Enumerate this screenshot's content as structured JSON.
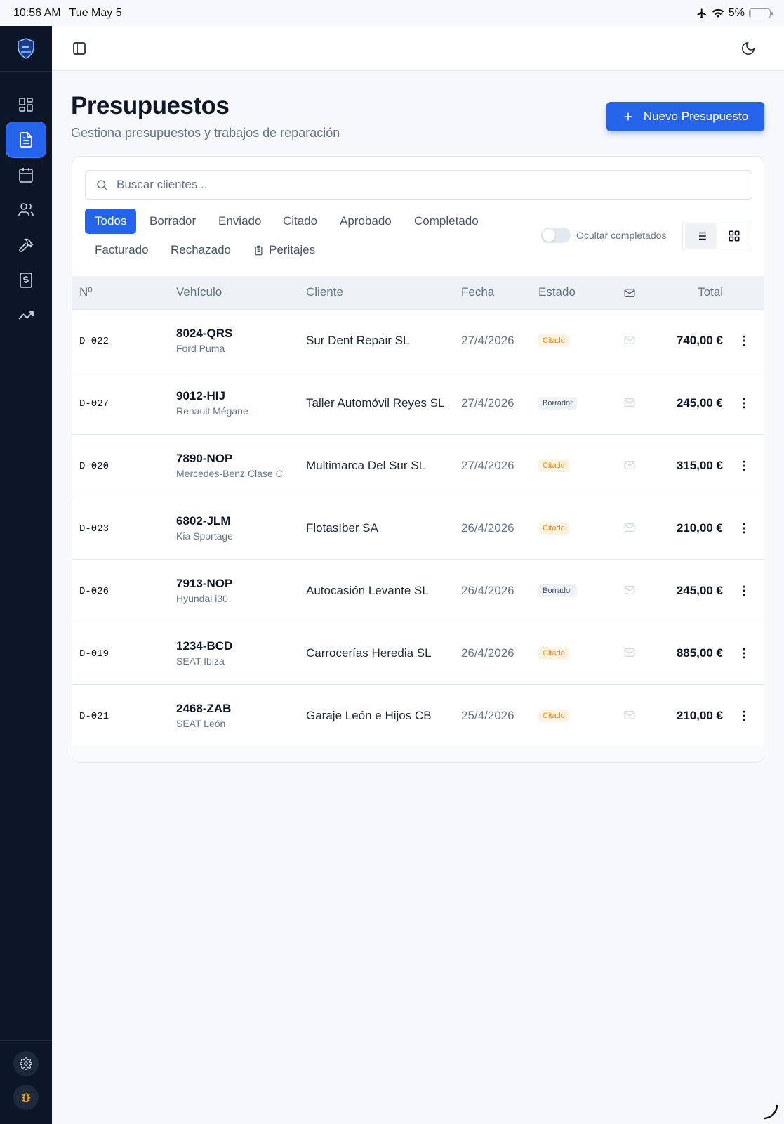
{
  "statusbar": {
    "time": "10:56 AM",
    "date": "Tue May 5",
    "battery": "5%",
    "battery_level": 0.05
  },
  "header": {
    "title": "Presupuestos",
    "subtitle": "Gestiona presupuestos y trabajos de reparación",
    "new_button": "Nuevo Presupuesto"
  },
  "search": {
    "placeholder": "Buscar clientes..."
  },
  "filters": {
    "todos": "Todos",
    "borrador": "Borrador",
    "enviado": "Enviado",
    "citado": "Citado",
    "aprobado": "Aprobado",
    "completado": "Completado",
    "facturado": "Facturado",
    "rechazado": "Rechazado",
    "peritajes": "Peritajes"
  },
  "toggle_label": "Ocultar completados",
  "table": {
    "headers": {
      "no": "Nº",
      "vehicle": "Vehículo",
      "client": "Cliente",
      "date": "Fecha",
      "status": "Estado",
      "total": "Total"
    },
    "rows": [
      {
        "no": "D-022",
        "plate": "8024-QRS",
        "model": "Ford Puma",
        "client": "Sur Dent Repair SL",
        "date": "27/4/2026",
        "status": "Citado",
        "total": "740,00 €"
      },
      {
        "no": "D-027",
        "plate": "9012-HIJ",
        "model": "Renault Mégane",
        "client": "Taller Automóvil Reyes SL",
        "date": "27/4/2026",
        "status": "Borrador",
        "total": "245,00 €"
      },
      {
        "no": "D-020",
        "plate": "7890-NOP",
        "model": "Mercedes-Benz Clase C",
        "client": "Multimarca Del Sur SL",
        "date": "27/4/2026",
        "status": "Citado",
        "total": "315,00 €"
      },
      {
        "no": "D-023",
        "plate": "6802-JLM",
        "model": "Kia Sportage",
        "client": "FlotasIber SA",
        "date": "26/4/2026",
        "status": "Citado",
        "total": "210,00 €"
      },
      {
        "no": "D-026",
        "plate": "7913-NOP",
        "model": "Hyundai i30",
        "client": "Autocasión Levante SL",
        "date": "26/4/2026",
        "status": "Borrador",
        "total": "245,00 €"
      },
      {
        "no": "D-019",
        "plate": "1234-BCD",
        "model": "SEAT Ibiza",
        "client": "Carrocerías Heredia SL",
        "date": "26/4/2026",
        "status": "Citado",
        "total": "885,00 €"
      },
      {
        "no": "D-021",
        "plate": "2468-ZAB",
        "model": "SEAT León",
        "client": "Garaje León e Hijos CB",
        "date": "25/4/2026",
        "status": "Citado",
        "total": "210,00 €"
      }
    ]
  },
  "colors": {
    "accent": "#2563eb",
    "sidebar": "#0d1528",
    "citado": "#ea8a0c"
  }
}
